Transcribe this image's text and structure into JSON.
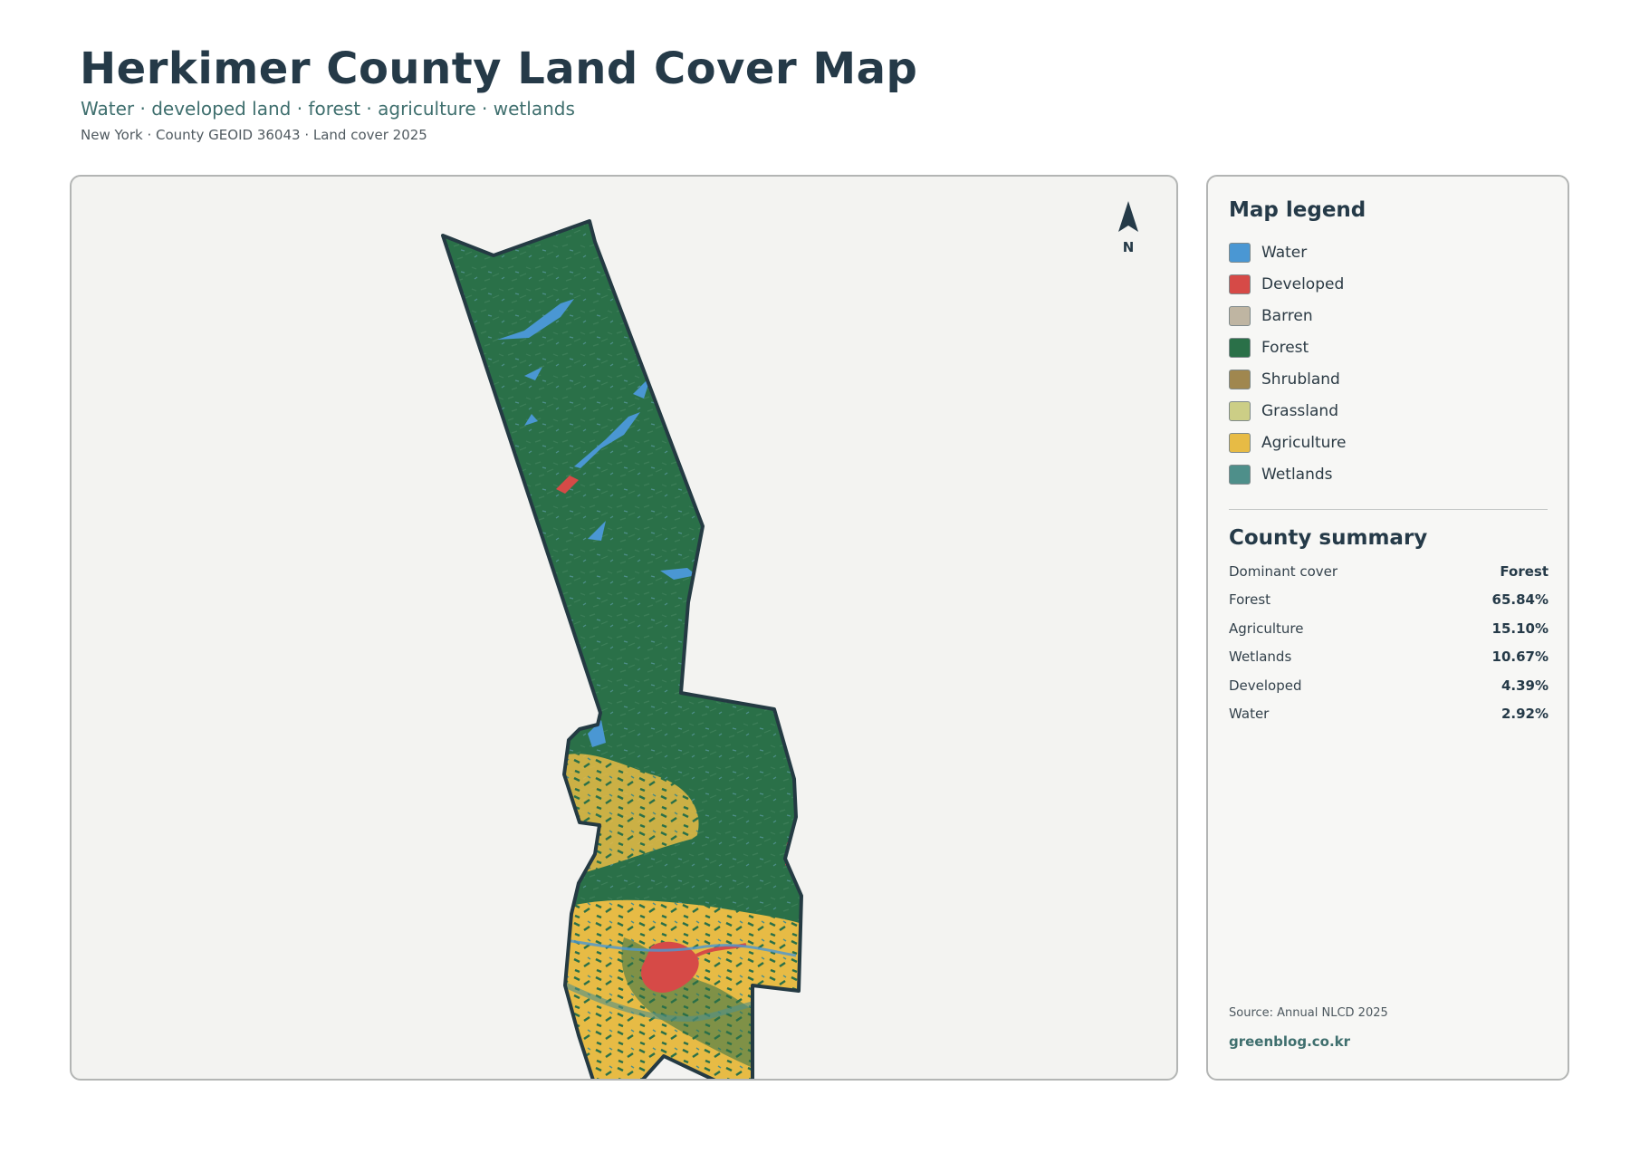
{
  "header": {
    "title": "Herkimer County Land Cover Map",
    "subtitle": "Water · developed land · forest · agriculture · wetlands",
    "meta": "New York · County GEOID 36043 · Land cover 2025"
  },
  "map": {
    "north_label": "N",
    "colors": {
      "background": "#f3f3f1",
      "outline": "#243a43"
    }
  },
  "legend": {
    "heading": "Map legend",
    "items": [
      {
        "label": "Water",
        "color": "#4a97d3"
      },
      {
        "label": "Developed",
        "color": "#d64a47"
      },
      {
        "label": "Barren",
        "color": "#bfb5a2"
      },
      {
        "label": "Forest",
        "color": "#2a7048"
      },
      {
        "label": "Shrubland",
        "color": "#a0874f"
      },
      {
        "label": "Grassland",
        "color": "#ccce86"
      },
      {
        "label": "Agriculture",
        "color": "#e7bb45"
      },
      {
        "label": "Wetlands",
        "color": "#4e8f8a"
      }
    ]
  },
  "summary": {
    "heading": "County summary",
    "rows": [
      {
        "label": "Dominant cover",
        "value": "Forest"
      },
      {
        "label": "Forest",
        "value": "65.84%"
      },
      {
        "label": "Agriculture",
        "value": "15.10%"
      },
      {
        "label": "Wetlands",
        "value": "10.67%"
      },
      {
        "label": "Developed",
        "value": "4.39%"
      },
      {
        "label": "Water",
        "value": "2.92%"
      }
    ]
  },
  "footer": {
    "source": "Source: Annual NLCD 2025",
    "site": "greenblog.co.kr"
  }
}
